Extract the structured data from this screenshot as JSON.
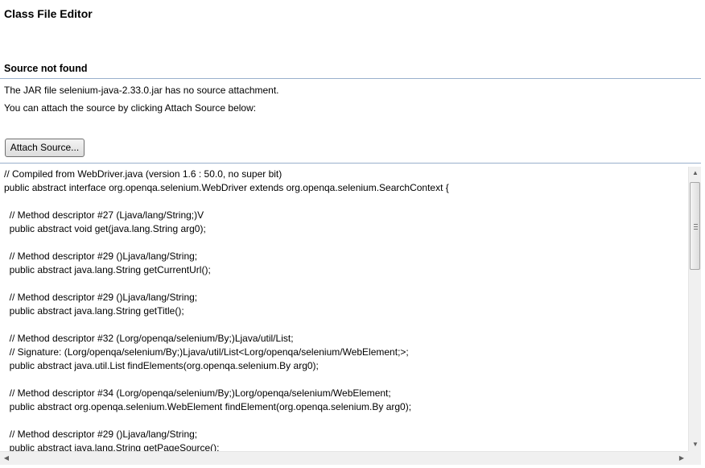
{
  "editor": {
    "title": "Class File Editor"
  },
  "source_section": {
    "heading": "Source not found",
    "message_line1": "The JAR file selenium-java-2.33.0.jar has no source attachment.",
    "message_line2": "You can attach the source by clicking Attach Source below:",
    "attach_button_label": "Attach Source..."
  },
  "code": {
    "lines": [
      "// Compiled from WebDriver.java (version 1.6 : 50.0, no super bit)",
      "public abstract interface org.openqa.selenium.WebDriver extends org.openqa.selenium.SearchContext {",
      "",
      "  // Method descriptor #27 (Ljava/lang/String;)V",
      "  public abstract void get(java.lang.String arg0);",
      "",
      "  // Method descriptor #29 ()Ljava/lang/String;",
      "  public abstract java.lang.String getCurrentUrl();",
      "",
      "  // Method descriptor #29 ()Ljava/lang/String;",
      "  public abstract java.lang.String getTitle();",
      "",
      "  // Method descriptor #32 (Lorg/openqa/selenium/By;)Ljava/util/List;",
      "  // Signature: (Lorg/openqa/selenium/By;)Ljava/util/List<Lorg/openqa/selenium/WebElement;>;",
      "  public abstract java.util.List findElements(org.openqa.selenium.By arg0);",
      "",
      "  // Method descriptor #34 (Lorg/openqa/selenium/By;)Lorg/openqa/selenium/WebElement;",
      "  public abstract org.openqa.selenium.WebElement findElement(org.openqa.selenium.By arg0);",
      "",
      "  // Method descriptor #29 ()Ljava/lang/String;",
      "  public abstract java.lang.String getPageSource();"
    ]
  },
  "scrollbars": {
    "vertical": {
      "up_icon": "arrow-up-icon",
      "down_icon": "arrow-down-icon",
      "position_fraction": 0.0
    },
    "horizontal": {
      "left_icon": "arrow-left-icon",
      "right_icon": "arrow-right-icon"
    }
  }
}
